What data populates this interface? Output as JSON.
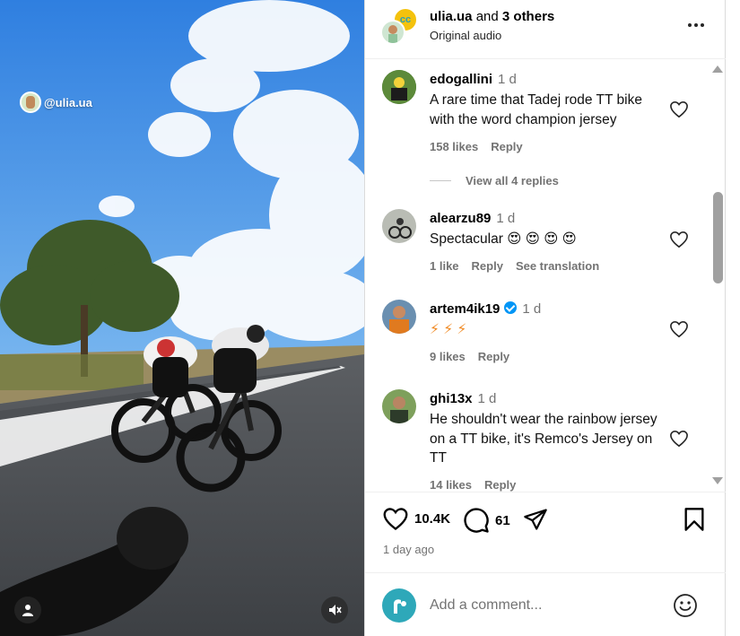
{
  "video": {
    "tag": "@ulia.ua",
    "profile_icon": "person-icon",
    "mute_icon": "speaker-muted-icon"
  },
  "header": {
    "owner": "ulia.ua",
    "owner_connector": "and",
    "owner_others": "3 others",
    "audio": "Original audio"
  },
  "comments": [
    {
      "user": "edogallini",
      "time": "1 d",
      "text": "A rare time that Tadej rode TT bike with the word champion jersey",
      "likes": "158 likes",
      "reply": "Reply",
      "view_replies": "View all 4 replies"
    },
    {
      "user": "alearzu89",
      "time": "1 d",
      "text": "Spectacular 😍 😍 😍 😍",
      "likes": "1 like",
      "reply": "Reply",
      "translate": "See translation"
    },
    {
      "user": "artem4ik19",
      "time": "1 d",
      "verified": true,
      "text": "⚡ ⚡ ⚡",
      "likes": "9 likes",
      "reply": "Reply"
    },
    {
      "user": "ghi13x",
      "time": "1 d",
      "text": "He shouldn't wear the rainbow jersey on a TT bike, it's Remco's Jersey on TT",
      "likes": "14 likes",
      "reply": "Reply"
    }
  ],
  "actions": {
    "like_count": "10.4K",
    "comment_count": "61",
    "date": "1 day ago"
  },
  "add_comment": {
    "placeholder": "Add a comment..."
  },
  "colors": {
    "verified": "#0095f6",
    "muted_text": "#737373",
    "avatar_brand": "#2ea8b9"
  }
}
